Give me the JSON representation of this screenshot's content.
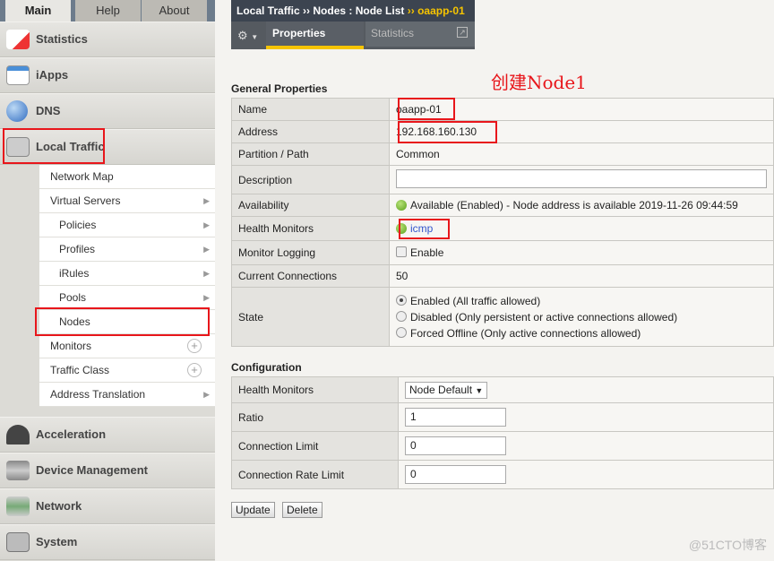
{
  "top_tabs": [
    "Main",
    "Help",
    "About"
  ],
  "sidebar": {
    "categories": [
      "Statistics",
      "iApps",
      "DNS",
      "Local Traffic",
      "Acceleration",
      "Device Management",
      "Network",
      "System"
    ],
    "sub_items": [
      {
        "label": "Network Map",
        "type": "none"
      },
      {
        "label": "Virtual Servers",
        "type": "arrow"
      },
      {
        "label": "Policies",
        "type": "arrow"
      },
      {
        "label": "Profiles",
        "type": "arrow"
      },
      {
        "label": "iRules",
        "type": "arrow"
      },
      {
        "label": "Pools",
        "type": "arrow"
      },
      {
        "label": "Nodes",
        "type": "none"
      },
      {
        "label": "Monitors",
        "type": "plus"
      },
      {
        "label": "Traffic Class",
        "type": "plus"
      },
      {
        "label": "Address Translation",
        "type": "arrow"
      }
    ]
  },
  "breadcrumb": {
    "part1": "Local Traffic",
    "sep": "››",
    "part2": "Nodes : Node List",
    "current": "oaapp-01"
  },
  "tabs": {
    "properties": "Properties",
    "statistics": "Statistics"
  },
  "annotation": "创建Node1",
  "general": {
    "title": "General Properties",
    "name_label": "Name",
    "name": "oaapp-01",
    "address_label": "Address",
    "address": "192.168.160.130",
    "partition_label": "Partition / Path",
    "partition": "Common",
    "description_label": "Description",
    "description": "",
    "availability_label": "Availability",
    "availability": "Available (Enabled) - Node address is available 2019-11-26 09:44:59",
    "health_label": "Health Monitors",
    "health": "icmp",
    "logging_label": "Monitor Logging",
    "logging": "Enable",
    "logging_checked": false,
    "conn_label": "Current Connections",
    "conn": "50",
    "state_label": "State",
    "state_options": [
      "Enabled (All traffic allowed)",
      "Disabled (Only persistent or active connections allowed)",
      "Forced Offline (Only active connections allowed)"
    ],
    "state_selected": 0
  },
  "config": {
    "title": "Configuration",
    "health_label": "Health Monitors",
    "health": "Node Default",
    "ratio_label": "Ratio",
    "ratio": "1",
    "limit_label": "Connection Limit",
    "limit": "0",
    "rate_label": "Connection Rate Limit",
    "rate": "0"
  },
  "buttons": {
    "update": "Update",
    "delete": "Delete"
  },
  "watermark": "@51CTO博客",
  "colors": {
    "highlight": "#e8161b",
    "accent": "#f6c400"
  }
}
